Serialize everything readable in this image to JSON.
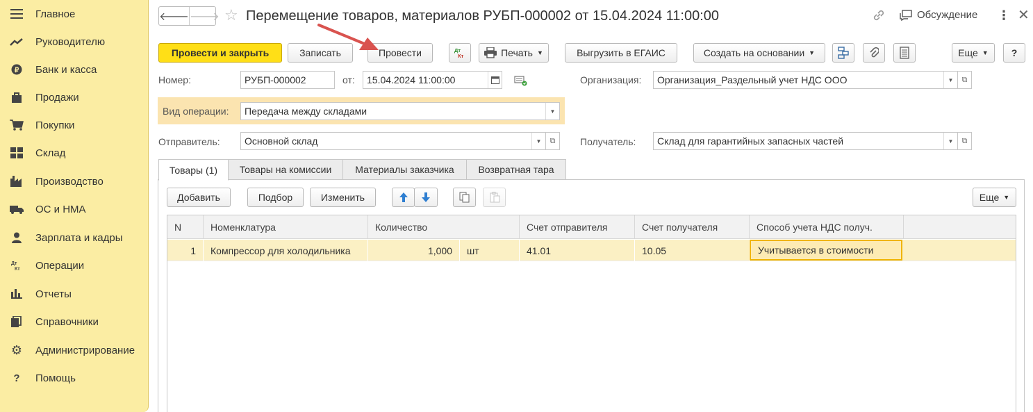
{
  "sidebar": {
    "items": [
      {
        "label": "Главное",
        "icon": "menu-icon"
      },
      {
        "label": "Руководителю",
        "icon": "trend-icon"
      },
      {
        "label": "Банк и касса",
        "icon": "coin-icon"
      },
      {
        "label": "Продажи",
        "icon": "bag-icon"
      },
      {
        "label": "Покупки",
        "icon": "cart-icon"
      },
      {
        "label": "Склад",
        "icon": "warehouse-icon"
      },
      {
        "label": "Производство",
        "icon": "factory-icon"
      },
      {
        "label": "ОС и НМА",
        "icon": "truck-icon"
      },
      {
        "label": "Зарплата и кадры",
        "icon": "person-icon"
      },
      {
        "label": "Операции",
        "icon": "dtkt-icon"
      },
      {
        "label": "Отчеты",
        "icon": "bar-chart-icon"
      },
      {
        "label": "Справочники",
        "icon": "books-icon"
      },
      {
        "label": "Администрирование",
        "icon": "gear-icon"
      },
      {
        "label": "Помощь",
        "icon": "question-icon"
      }
    ]
  },
  "header": {
    "title": "Перемещение товаров, материалов РУБП-000002 от 15.04.2024 11:00:00",
    "discussion": "Обсуждение"
  },
  "toolbar": {
    "post_close": "Провести и закрыть",
    "save": "Записать",
    "post": "Провести",
    "dtkt": "Дт Кт",
    "print": "Печать",
    "egais": "Выгрузить в ЕГАИС",
    "create_based": "Создать на основании",
    "more": "Еще",
    "help": "?"
  },
  "form": {
    "number_label": "Номер:",
    "number_value": "РУБП-000002",
    "date_label": "от:",
    "date_value": "15.04.2024 11:00:00",
    "org_label": "Организация:",
    "org_value": "Организация_Раздельный учет НДС ООО",
    "op_label": "Вид операции:",
    "op_value": "Передача между складами",
    "sender_label": "Отправитель:",
    "sender_value": "Основной склад",
    "receiver_label": "Получатель:",
    "receiver_value": "Склад для гарантийных запасных частей"
  },
  "tabs": [
    {
      "label": "Товары (1)"
    },
    {
      "label": "Товары на комиссии"
    },
    {
      "label": "Материалы заказчика"
    },
    {
      "label": "Возвратная тара"
    }
  ],
  "table_toolbar": {
    "add": "Добавить",
    "pick": "Подбор",
    "edit": "Изменить",
    "more": "Еще"
  },
  "table": {
    "columns": [
      "N",
      "Номенклатура",
      "Количество",
      "Счет отправителя",
      "Счет получателя",
      "Способ учета НДС получ."
    ],
    "rows": [
      {
        "n": "1",
        "item": "Компрессор для холодильника",
        "qty": "1,000",
        "unit": "шт",
        "acc_from": "41.01",
        "acc_to": "10.05",
        "vat": "Учитывается в стоимости"
      }
    ]
  },
  "colors": {
    "sidebar_bg": "#fbeda3",
    "primary_button": "#ffdf17",
    "row_highlight": "#fbf0c4",
    "annotation_arrow": "#d9534f"
  }
}
